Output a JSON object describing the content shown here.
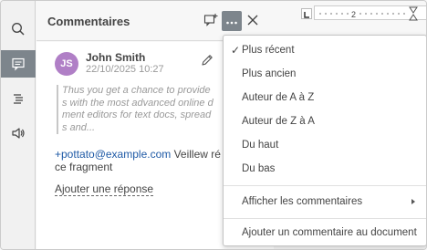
{
  "toolstrip": {
    "items": [
      {
        "icon": "search-icon"
      },
      {
        "icon": "comment-icon",
        "active": true
      },
      {
        "icon": "navigation-icon"
      },
      {
        "icon": "speaker-icon"
      }
    ]
  },
  "panel": {
    "title": "Commentaires",
    "buttons": [
      "add-comment-icon",
      "more-icon",
      "close-icon"
    ]
  },
  "comment": {
    "avatar_initials": "JS",
    "avatar_color": "#b07fc6",
    "author": "John Smith",
    "date": "22/10/2025 10:27",
    "quote_lines": [
      "Thus you get a chance to provide",
      "s with the most advanced online d",
      "ment editors for text docs, spread",
      "s and..."
    ],
    "mention": "+pottato@example.com",
    "reply_rest": " Veillew ré",
    "reply_line2": "ce fragment",
    "add_reply": "Ajouter une réponse"
  },
  "ruler": {
    "label": "2"
  },
  "menu": {
    "items": [
      {
        "label": "Plus récent",
        "checked": true
      },
      {
        "label": "Plus ancien"
      },
      {
        "label": "Auteur de A à Z"
      },
      {
        "label": "Auteur de Z à A"
      },
      {
        "label": "Du haut"
      },
      {
        "label": "Du bas"
      }
    ],
    "show_comments": "Afficher les commentaires",
    "add_doc_comment": "Ajouter un commentaire au document"
  },
  "colors": {
    "accent_mention": "#1f5aa6",
    "active_tool": "#7d858c"
  }
}
